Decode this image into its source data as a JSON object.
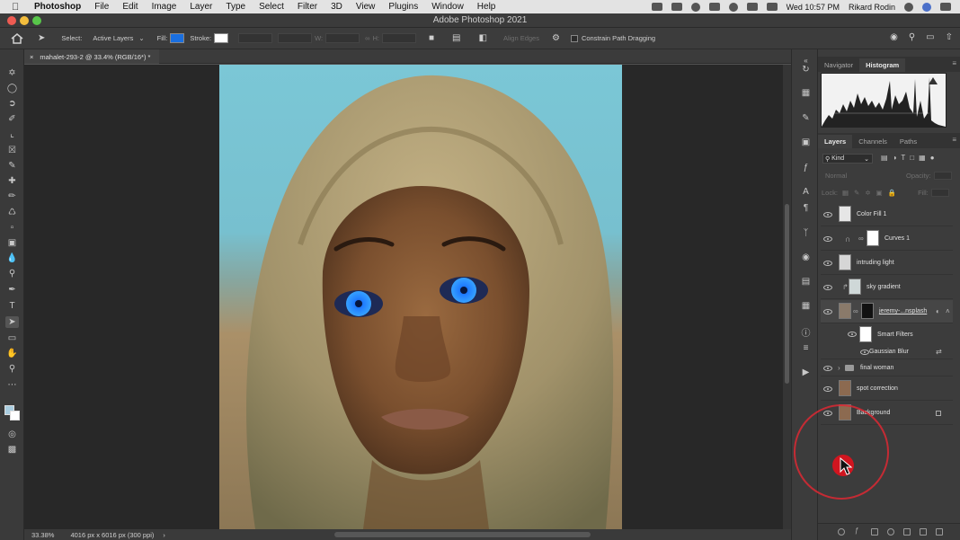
{
  "menubar": {
    "items": [
      "Photoshop",
      "File",
      "Edit",
      "Image",
      "Layer",
      "Type",
      "Select",
      "Filter",
      "3D",
      "View",
      "Plugins",
      "Window",
      "Help"
    ],
    "clock": "Wed 10:57 PM",
    "user": "Rikard Rodin"
  },
  "window": {
    "title": "Adobe Photoshop 2021"
  },
  "options": {
    "select_label": "Select:",
    "select_value": "Active Layers",
    "fill_label": "Fill:",
    "stroke_label": "Stroke:",
    "w_label": "W:",
    "h_label": "H:",
    "align_edges": "Align Edges",
    "constrain": "Constrain Path Dragging",
    "fill_color": "#1a6fe0"
  },
  "document": {
    "tab_title": "mahalet-293-2 @ 33.4% (RGB/16*) *"
  },
  "status": {
    "zoom": "33.38%",
    "dimensions": "4016 px x 6016 px (300 ppi)"
  },
  "panels": {
    "top_tabs": [
      "Navigator",
      "Histogram"
    ],
    "layer_tabs": [
      "Layers",
      "Channels",
      "Paths"
    ],
    "kind_filter": "Kind",
    "blend_mode": "Normal",
    "opacity_label": "Opacity:",
    "lock_label": "Lock:",
    "fill_label": "Fill:",
    "layers": [
      {
        "name": "Color Fill 1"
      },
      {
        "name": "Curves 1"
      },
      {
        "name": "intruding light"
      },
      {
        "name": "sky gradient"
      },
      {
        "name": "jeremy-...nsplash"
      },
      {
        "name": "Smart Filters"
      },
      {
        "name": "Gaussian Blur"
      },
      {
        "name": "final woman"
      },
      {
        "name": "spot correction"
      },
      {
        "name": "Background"
      }
    ]
  },
  "colors": {
    "eye_highlight": "#1f7bff",
    "cursor": "#d1151f"
  }
}
